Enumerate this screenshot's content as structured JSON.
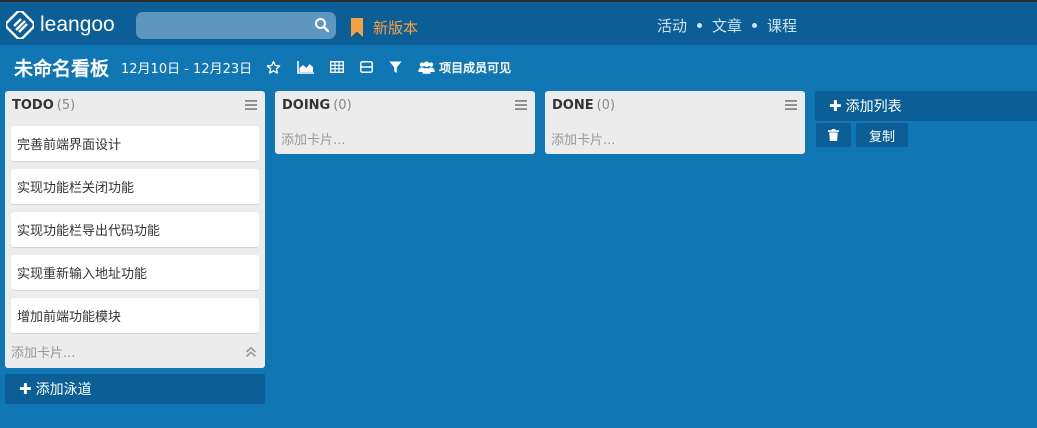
{
  "app": {
    "logo_text": "leangoo",
    "new_version_label": "新版本"
  },
  "search": {
    "placeholder": "",
    "value": ""
  },
  "topnav": {
    "items": [
      "活动",
      "文章",
      "课程"
    ]
  },
  "board": {
    "title": "未命名看板",
    "date_range": "12月10日 - 12月23日",
    "visibility_label": "项目成员可见"
  },
  "lists": [
    {
      "name": "TODO",
      "count": "(5)",
      "cards": [
        "完善前端界面设计",
        "实现功能栏关闭功能",
        "实现功能栏导出代码功能",
        "实现重新输入地址功能",
        "增加前端功能模块"
      ],
      "add_card_label": "添加卡片..."
    },
    {
      "name": "DOING",
      "count": "(0)",
      "cards": [],
      "add_card_label": "添加卡片..."
    },
    {
      "name": "DONE",
      "count": "(0)",
      "cards": [],
      "add_card_label": "添加卡片..."
    }
  ],
  "actions": {
    "add_list_label": "添加列表",
    "copy_label": "复制",
    "add_lane_label": "添加泳道"
  },
  "colors": {
    "background": "#1076b4",
    "topbar": "#0c5f96",
    "accent_orange": "#f6a142",
    "list_bg": "#ececec"
  },
  "icons": {
    "logo": "leangoo-logo-icon",
    "search": "search-icon",
    "bookmark": "bookmark-icon",
    "star": "star-icon",
    "chart": "area-chart-icon",
    "table": "table-icon",
    "swimlane": "swimlane-icon",
    "filter": "filter-icon",
    "users": "users-icon",
    "menu": "hamburger-menu-icon",
    "collapse": "double-chevron-up-icon",
    "trash": "trash-icon",
    "plus": "plus-icon"
  }
}
